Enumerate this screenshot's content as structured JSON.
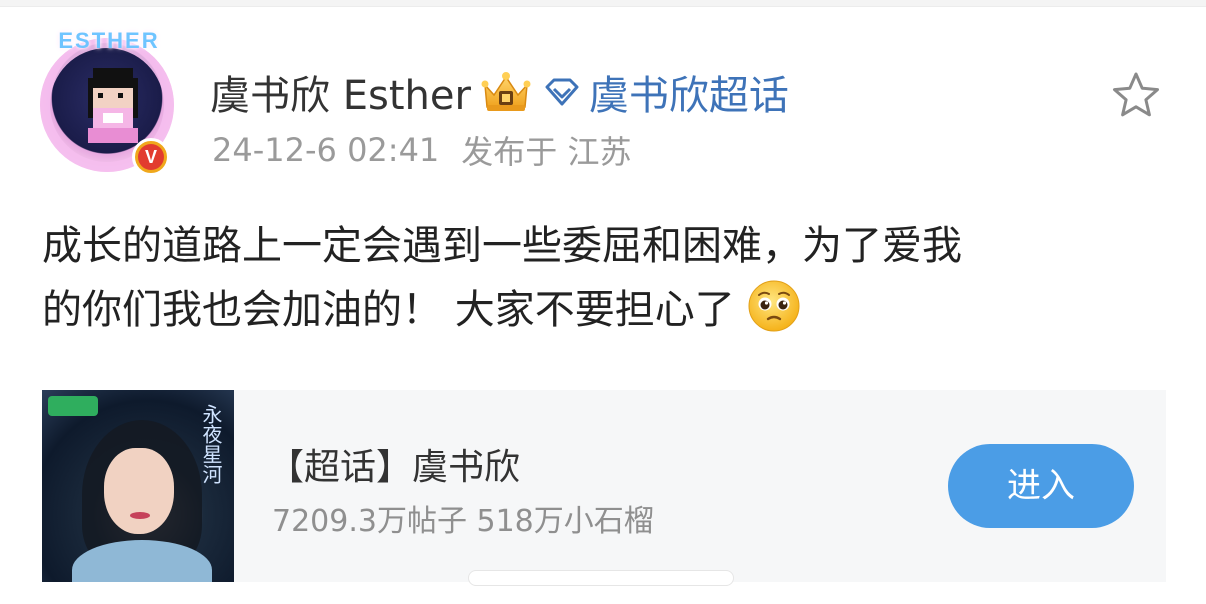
{
  "post": {
    "author": {
      "name": "虞书欣 Esther",
      "avatar_text": "ESTHER",
      "verified_badge": "V"
    },
    "supertopic_link": "虞书欣超话",
    "timestamp": "24-12-6 02:41",
    "location": "发布于 江苏",
    "text_line1": "成长的道路上一定会遇到一些委屈和困难，为了爱我",
    "text_line2": "的你们我也会加油的！ 大家不要担心了",
    "icons": {
      "crown": "crown-icon",
      "diamond": "diamond-icon",
      "star": "star-icon",
      "emoji": "pleading-face-emoji"
    }
  },
  "card": {
    "title": "【超话】虞书欣",
    "stats": "7209.3万帖子 518万小石榴",
    "enter_label": "进入",
    "cover_title": "永夜星河"
  },
  "colors": {
    "link_blue": "#3e73b8",
    "button_blue": "#4b9de6",
    "meta_gray": "#9a9a9a",
    "card_bg": "#f6f7f8"
  }
}
